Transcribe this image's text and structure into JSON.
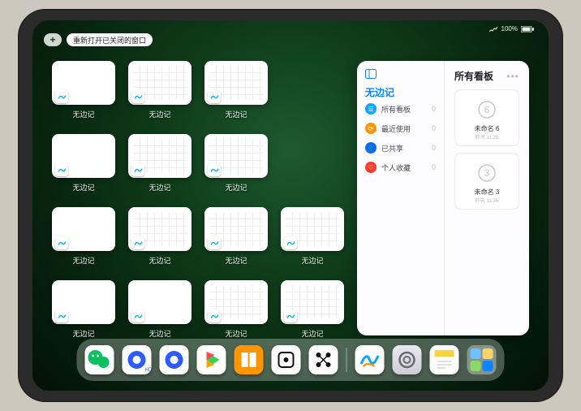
{
  "status": {
    "battery": "100%"
  },
  "topbar": {
    "plus": "+",
    "reopen": "重新打开已关闭的窗口"
  },
  "thumbs": {
    "label": "无边记"
  },
  "panel": {
    "title": "无边记",
    "right_title": "所有看板",
    "items": [
      {
        "label": "所有看板",
        "count": "0",
        "color": "#0aa7ff"
      },
      {
        "label": "最近使用",
        "count": "0",
        "color": "#ff9500"
      },
      {
        "label": "已共享",
        "count": "0",
        "color": "#0a6bff"
      },
      {
        "label": "个人收藏",
        "count": "0",
        "color": "#ff3b30"
      }
    ],
    "boards": [
      {
        "name": "未命名 6",
        "meta": "昨天 11:28",
        "digit": "6"
      },
      {
        "name": "未命名 3",
        "meta": "昨天 11:25",
        "digit": "3"
      }
    ]
  },
  "dock": [
    "wechat",
    "quark-hd",
    "quark",
    "play",
    "books",
    "dice",
    "connect",
    "|",
    "freeform",
    "settings",
    "notes",
    "folder"
  ]
}
